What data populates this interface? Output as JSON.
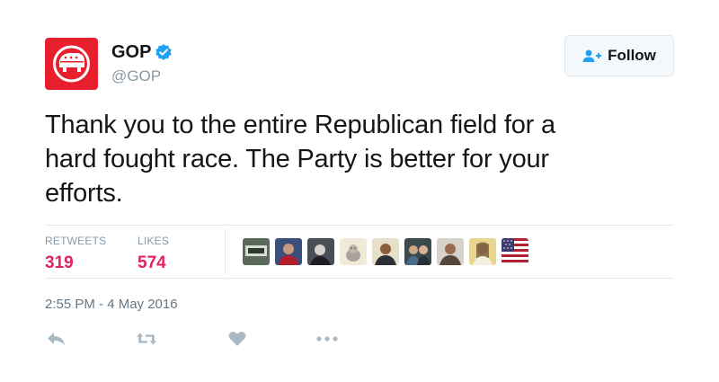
{
  "account": {
    "name": "GOP",
    "handle": "@GOP",
    "verified": true,
    "avatar_icon": "republican-elephant-logo",
    "avatar_color": "#e8202d"
  },
  "follow_button": {
    "label": "Follow",
    "icon": "add-user-icon"
  },
  "tweet": {
    "lines": [
      "Thank you to the entire Republican field for a",
      "hard fought race. The Party is better for your",
      "efforts."
    ]
  },
  "stats": {
    "retweets_label": "RETWEETS",
    "retweets_value": "319",
    "likes_label": "LIKES",
    "likes_value": "574",
    "value_color": "#e0245e"
  },
  "likers": [
    {
      "icon": "liker-avatar-icon",
      "color": "#5a6a58"
    },
    {
      "icon": "liker-avatar-icon",
      "color": "#3a4f7a"
    },
    {
      "icon": "liker-avatar-icon",
      "color": "#4a4f55"
    },
    {
      "icon": "liker-avatar-icon",
      "color": "#f2ead8"
    },
    {
      "icon": "liker-avatar-icon",
      "color": "#2c2f36"
    },
    {
      "icon": "liker-avatar-icon",
      "color": "#3b4a4c"
    },
    {
      "icon": "liker-avatar-icon",
      "color": "#55463b"
    },
    {
      "icon": "liker-avatar-icon",
      "color": "#e8d690"
    },
    {
      "icon": "us-flag-icon",
      "color": "#b22234"
    }
  ],
  "timestamp": "2:55 PM - 4 May 2016",
  "actions": {
    "reply_icon": "reply-icon",
    "retweet_icon": "retweet-icon",
    "like_icon": "heart-icon",
    "more_icon": "more-dots-icon",
    "icon_color": "#aab8c2"
  }
}
